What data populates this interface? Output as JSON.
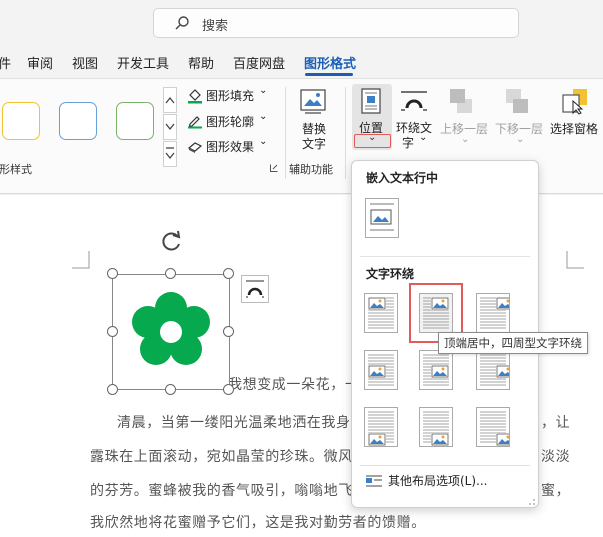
{
  "search": {
    "placeholder": "搜索"
  },
  "tabs": [
    {
      "label": "件"
    },
    {
      "label": "审阅"
    },
    {
      "label": "视图"
    },
    {
      "label": "开发工具"
    },
    {
      "label": "帮助"
    },
    {
      "label": "百度网盘"
    },
    {
      "label": "图形格式",
      "active": true
    }
  ],
  "ribbon": {
    "shape_styles_label": "形样式",
    "fill": "图形填充",
    "outline": "图形轮廓",
    "effects": "图形效果",
    "replace_text_line1": "替换",
    "replace_text_line2": "文字",
    "aux_label": "辅助功能",
    "position": "位置",
    "wrap_line1": "环绕文",
    "wrap_line2": "字",
    "bring_forward": "上移一层",
    "send_backward": "下移一层",
    "selection_pane": "选择窗格"
  },
  "colors": {
    "accent": "#1a5fb4",
    "flower": "#06a94d",
    "highlight": "#e35a5a",
    "swatch_yellow": "#f2c232",
    "swatch_blue": "#6a9ed8",
    "swatch_green": "#7ab46b"
  },
  "dropdown": {
    "inline_heading": "嵌入文本行中",
    "wrap_heading": "文字环绕",
    "more_options": "其他布局选项(L)...",
    "tooltip": "顶端居中，四周型文字环绕"
  },
  "document": {
    "line1": "我想变成一朵花，",
    "line2a": "清晨，当第一缕阳光温柔地洒在我身上",
    "line2b": "，让",
    "line3a": "露珠在上面滚动，宛如晶莹的珍珠。微风",
    "line3b": "淡淡",
    "line4a": "的芬芳。蜜蜂被我的香气吸引，嗡嗡地飞",
    "line4b": "蜜，",
    "line5": "我欣然地将花蜜赠予它们，这是我对勤劳者的馈赠。"
  }
}
